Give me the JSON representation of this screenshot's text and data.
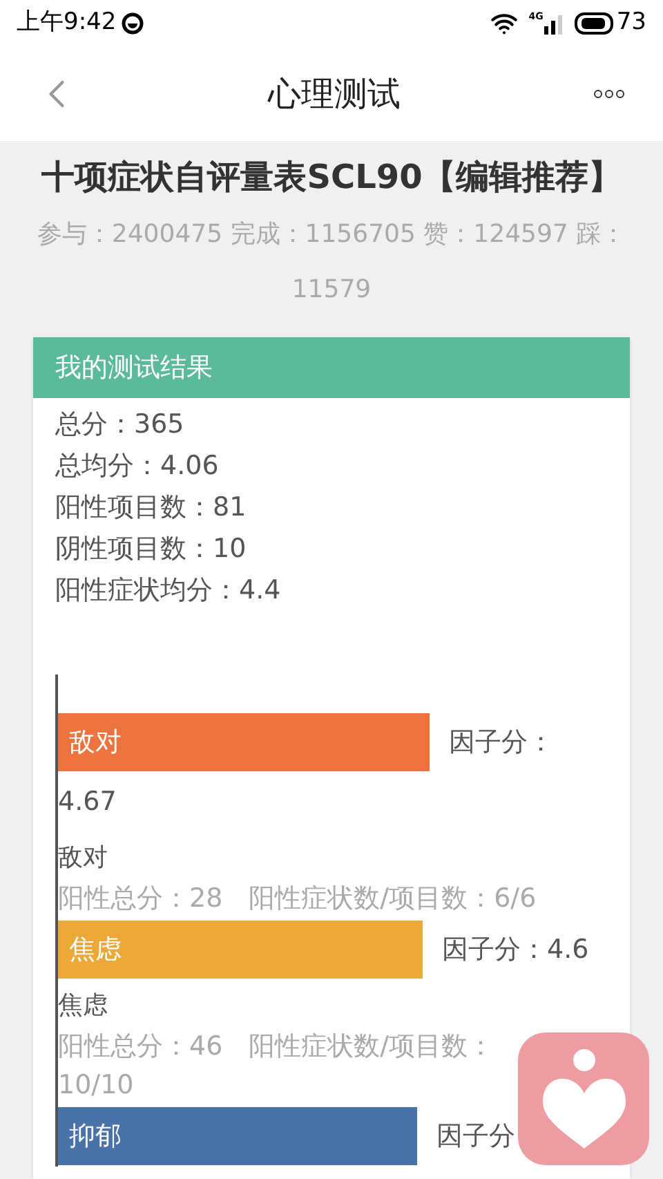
{
  "status_bar": {
    "time": "上午9:42",
    "network": "4G",
    "battery": "73"
  },
  "nav": {
    "title": "心理测试"
  },
  "test": {
    "title": "十项症状自评量表SCL90【编辑推荐】",
    "stats": "参与：2400475 完成：1156705 赞：124597 踩：11579"
  },
  "result": {
    "header": "我的测试结果",
    "summary": [
      "总分：365",
      "总均分：4.06",
      "阳性项目数：81",
      "阴性项目数：10",
      "阳性症状均分：4.4"
    ],
    "factors": [
      {
        "label": "敌对",
        "color": "#ec733e",
        "factor_label": "因子分：",
        "factor_value": "4.67",
        "name": "敌对",
        "stats": "阳性总分：28　阳性症状数/项目数：6/6"
      },
      {
        "label": "焦虑",
        "color": "#eaa838",
        "factor_label": "因子分：",
        "factor_value": "4.6",
        "name": "焦虑",
        "stats": "阳性总分：46　阳性症状数/项目数：10/10"
      },
      {
        "label": "抑郁",
        "color": "#4a72aa",
        "factor_label": "因子分"
      }
    ]
  }
}
